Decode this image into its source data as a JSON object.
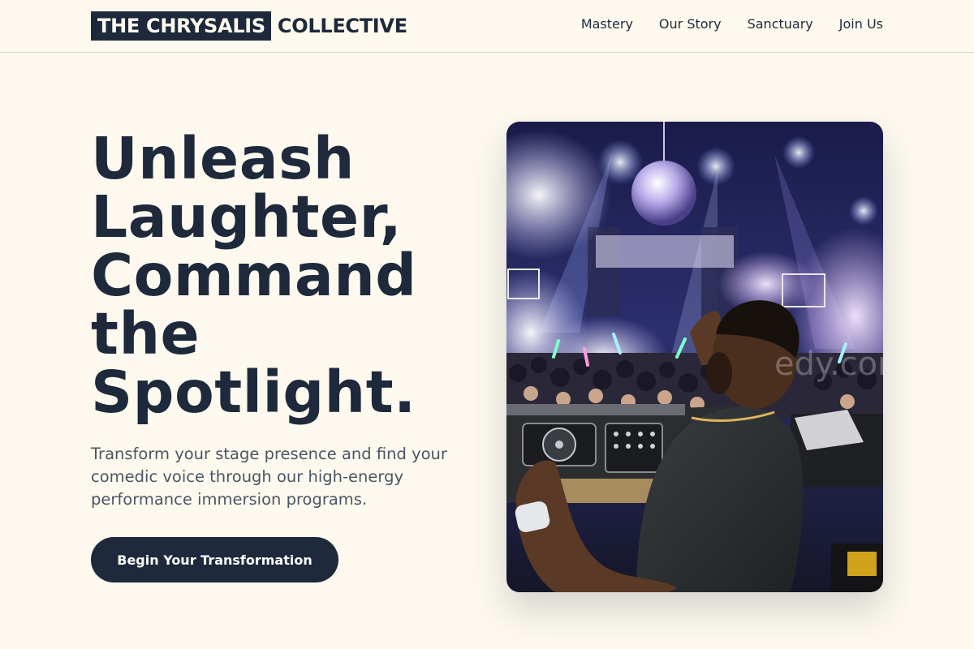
{
  "brand": {
    "highlight": "THE CHRYSALIS",
    "rest": "COLLECTIVE"
  },
  "nav": {
    "items": [
      {
        "label": "Mastery"
      },
      {
        "label": "Our Story"
      },
      {
        "label": "Sanctuary"
      },
      {
        "label": "Join Us"
      }
    ]
  },
  "hero": {
    "title_lines": [
      "Unleash",
      "Laughter,",
      "Command",
      "the",
      "Spotlight."
    ],
    "subtitle": "Transform your stage presence and find your comedic voice through our high-energy performance immersion programs.",
    "cta_label": "Begin Your Transformation"
  },
  "colors": {
    "background": "#fdf9ee",
    "navy": "#1e293b",
    "muted_text": "#4b5563"
  }
}
